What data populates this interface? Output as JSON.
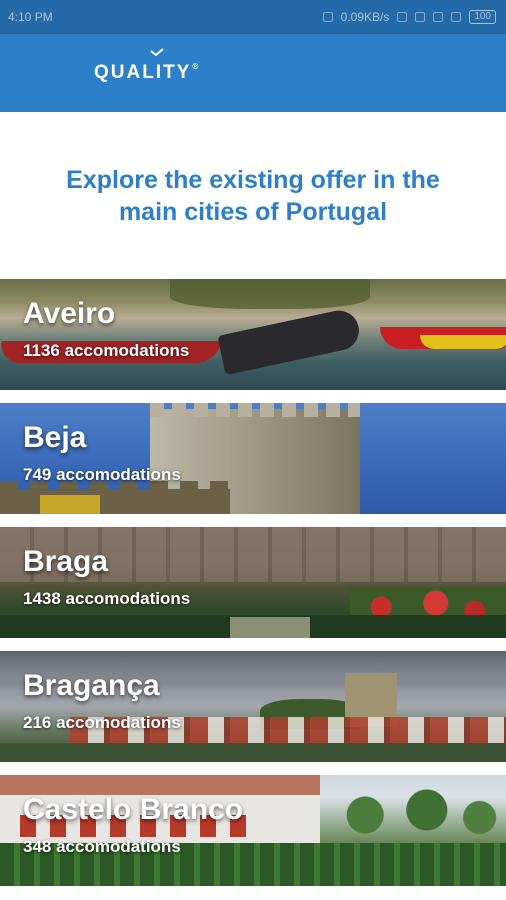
{
  "status_bar": {
    "time": "4:10 PM",
    "network_speed": "0.09KB/s",
    "battery": "100"
  },
  "header": {
    "logo_text": "QUALITY",
    "logo_mark": "®"
  },
  "intro": {
    "headline": "Explore the existing offer in the main cities of Portugal"
  },
  "cities": [
    {
      "name": "Aveiro",
      "count": "1136 accomodations"
    },
    {
      "name": "Beja",
      "count": "749 accomodations"
    },
    {
      "name": "Braga",
      "count": "1438 accomodations"
    },
    {
      "name": "Bragança",
      "count": "216 accomodations"
    },
    {
      "name": "Castelo Branco",
      "count": "348 accomodations"
    }
  ]
}
